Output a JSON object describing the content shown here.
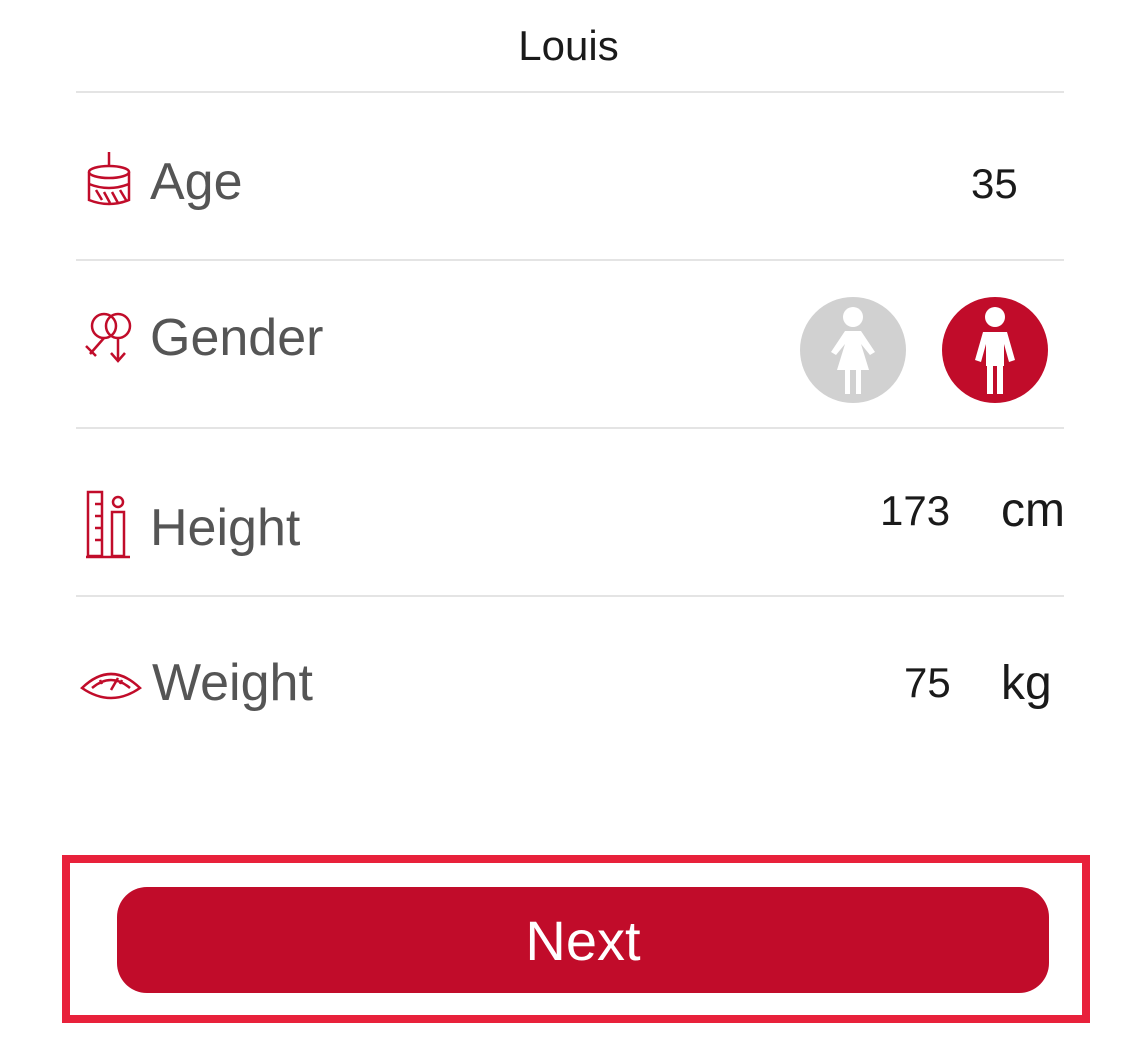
{
  "profile": {
    "name": "Louis"
  },
  "rows": {
    "age": {
      "label": "Age",
      "value": "35",
      "icon": "cake-icon"
    },
    "gender": {
      "label": "Gender",
      "icon": "gender-icon",
      "options": [
        "female",
        "male"
      ],
      "selected": "male"
    },
    "height": {
      "label": "Height",
      "value": "173",
      "unit": "cm",
      "icon": "height-ruler-icon"
    },
    "weight": {
      "label": "Weight",
      "value": "75",
      "unit": "kg",
      "icon": "scale-icon"
    }
  },
  "actions": {
    "next_label": "Next"
  },
  "colors": {
    "accent": "#c10c2a",
    "inactive": "#d1d1d1",
    "highlight": "#e8213b",
    "label": "#555555"
  }
}
